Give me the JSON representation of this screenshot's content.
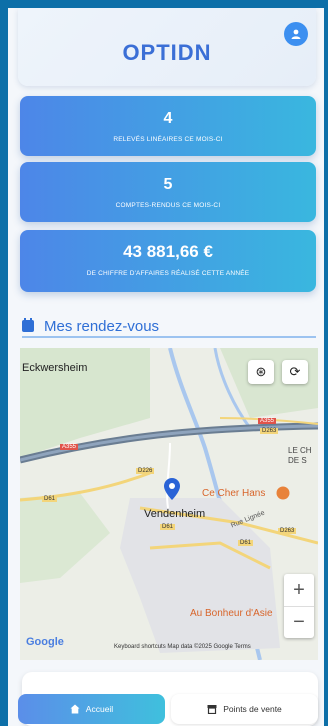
{
  "header": {
    "brand": "OPTIDN",
    "avatar_icon": "user-icon"
  },
  "stats": [
    {
      "value": "4",
      "label": "RELEVÉS LINÉAIRES CE MOIS-CI"
    },
    {
      "value": "5",
      "label": "COMPTES-RENDUS CE MOIS-CI"
    },
    {
      "value": "43 881,66 €",
      "label": "DE CHIFFRE D'AFFAIRES RÉALISÉ CETTE ANNÉE"
    }
  ],
  "section": {
    "title": "Mes rendez-vous",
    "icon": "calendar-icon"
  },
  "map": {
    "places": {
      "eckwersheim": "Eckwersheim",
      "vendenheim": "Vendenheim",
      "le_ch": "LE CH",
      "de_s": "DE S",
      "ce_cher_hans": "Ce Cher Hans",
      "au_bonheur": "Au Bonheur d'Asie",
      "rue_lignee": "Rue Lignée"
    },
    "roads": [
      "A355",
      "D263",
      "D226",
      "D61",
      "D61",
      "D263",
      "D61",
      "A355"
    ],
    "controls": {
      "layers_icon": "layers-icon",
      "refresh_icon": "refresh-icon",
      "zoom_in": "+",
      "zoom_out": "−"
    },
    "logo": "Google",
    "attribution": "Keyboard shortcuts   Map data ©2025 Google   Terms"
  },
  "nav": {
    "home": {
      "label": "Accueil",
      "icon": "home-icon"
    },
    "points": {
      "label": "Points de vente",
      "icon": "store-icon"
    }
  }
}
